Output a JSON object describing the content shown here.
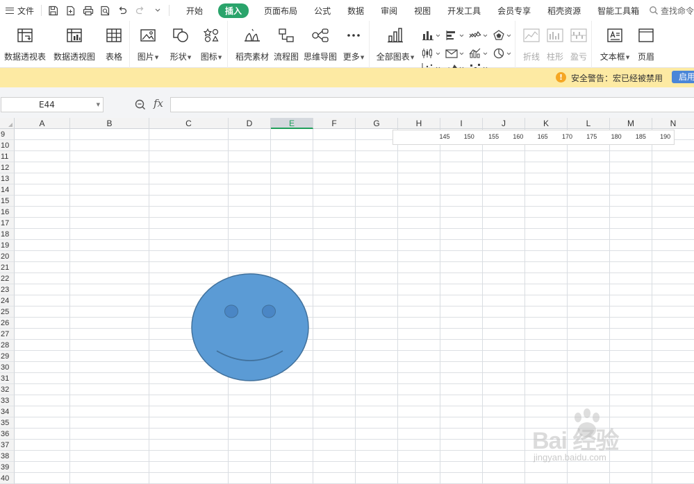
{
  "menubar": {
    "file_label": "文件",
    "tabs": [
      {
        "label": "开始"
      },
      {
        "label": "插入",
        "active": true
      },
      {
        "label": "页面布局"
      },
      {
        "label": "公式"
      },
      {
        "label": "数据"
      },
      {
        "label": "审阅"
      },
      {
        "label": "视图"
      },
      {
        "label": "开发工具"
      },
      {
        "label": "会员专享"
      },
      {
        "label": "稻壳资源"
      },
      {
        "label": "智能工具箱"
      }
    ],
    "search_label": "查找命令",
    "active_color": "#2aa46b"
  },
  "ribbon": {
    "pivot_table": "数据透视表",
    "pivot_chart": "数据透视图",
    "table": "表格",
    "picture": "图片",
    "shape": "形状",
    "icon": "图标",
    "docer_material": "稻壳素材",
    "flowchart": "流程图",
    "mindmap": "思维导图",
    "more": "更多",
    "all_charts": "全部图表",
    "line": "折线",
    "column": "柱形",
    "winloss": "盈亏",
    "textbox": "文本框",
    "header_footer": "页眉"
  },
  "security": {
    "icon": "!",
    "message": "安全警告：宏已经被禁用",
    "enable_button": "启用"
  },
  "formula_bar": {
    "name_box": "E44",
    "fx_symbol": "fx",
    "formula": ""
  },
  "sheet": {
    "columns": [
      "A",
      "B",
      "C",
      "D",
      "E",
      "F",
      "G",
      "H",
      "I",
      "J",
      "K",
      "L",
      "M",
      "N"
    ],
    "selected_column": "E",
    "rows": [
      "9",
      "10",
      "11",
      "12",
      "13",
      "14",
      "15",
      "16",
      "17",
      "18",
      "19",
      "20",
      "21",
      "22",
      "23",
      "24",
      "25",
      "26",
      "27",
      "28",
      "29",
      "30",
      "31",
      "32",
      "33",
      "34",
      "35",
      "36",
      "37",
      "38",
      "39",
      "40"
    ]
  },
  "chart_axis": {
    "ticks": [
      "145",
      "150",
      "155",
      "160",
      "165",
      "170",
      "175",
      "180",
      "185",
      "190"
    ]
  },
  "smiley": {
    "fill": "#5b9bd5",
    "stroke": "#41719c",
    "eye_fill": "#4a86c5"
  },
  "watermark": {
    "main": "Bai 经验",
    "sub": "jingyan.baidu.com"
  }
}
